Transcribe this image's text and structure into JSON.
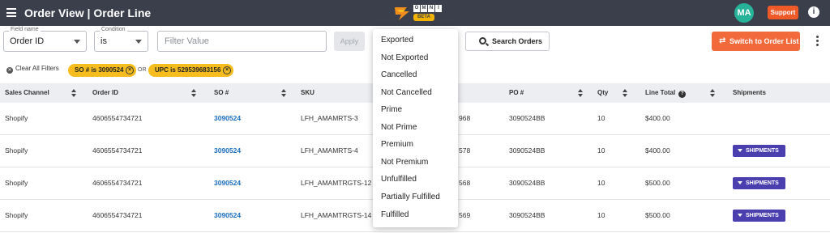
{
  "header": {
    "title": "Order View | Order Line",
    "logo_text": "OMNI",
    "logo_letters": [
      "O",
      "M",
      "N",
      "I"
    ],
    "logo_badge": "BETA",
    "avatar_initials": "MA",
    "support_label": "Support",
    "colors": {
      "bar": "#3a3f4b",
      "avatar": "#26b39a",
      "support": "#f05a28"
    }
  },
  "filters": {
    "field": {
      "label": "Field name",
      "value": "Order ID"
    },
    "condition": {
      "label": "Condition",
      "value": "is"
    },
    "value_placeholder": "Filter Value",
    "apply_label": "Apply",
    "search_label": "Search Orders",
    "switch_label": "Switch to Order List"
  },
  "active_filters": {
    "clear_label": "Clear All Filters",
    "chips": [
      "SO # is 3090524",
      "UPC is 529539683156"
    ],
    "joiner": "OR"
  },
  "table": {
    "columns": [
      "Sales Channel",
      "Order ID",
      "SO #",
      "SKU",
      "PO #",
      "Qty",
      "Line Total",
      "Shipments"
    ],
    "rows": [
      {
        "channel": "Shopify",
        "order_id": "4606554734721",
        "so": "3090524",
        "sku": "LFH_AMAMRTS-3",
        "upc_tail": "968",
        "po": "3090524BB",
        "qty": "10",
        "total": "$400.00",
        "shipments": ""
      },
      {
        "channel": "Shopify",
        "order_id": "4606554734721",
        "so": "3090524",
        "sku": "LFH_AMAMRTS-4",
        "upc_tail": "578",
        "po": "3090524BB",
        "qty": "10",
        "total": "$400.00",
        "shipments": "SHIPMENTS"
      },
      {
        "channel": "Shopify",
        "order_id": "4606554734721",
        "so": "3090524",
        "sku": "LFH_AMAMTRGTS-12",
        "upc_tail": "568",
        "po": "3090524BB",
        "qty": "10",
        "total": "$500.00",
        "shipments": "SHIPMENTS"
      },
      {
        "channel": "Shopify",
        "order_id": "4606554734721",
        "so": "3090524",
        "sku": "LFH_AMAMTRGTS-14",
        "upc_tail": "569",
        "po": "3090524BB",
        "qty": "10",
        "total": "$500.00",
        "shipments": "SHIPMENTS"
      }
    ]
  },
  "dropdown": {
    "options": [
      "Exported",
      "Not Exported",
      "Cancelled",
      "Not Cancelled",
      "Prime",
      "Not Prime",
      "Premium",
      "Not Premium",
      "Unfulfilled",
      "Partially Fulfilled",
      "Fulfilled"
    ]
  }
}
